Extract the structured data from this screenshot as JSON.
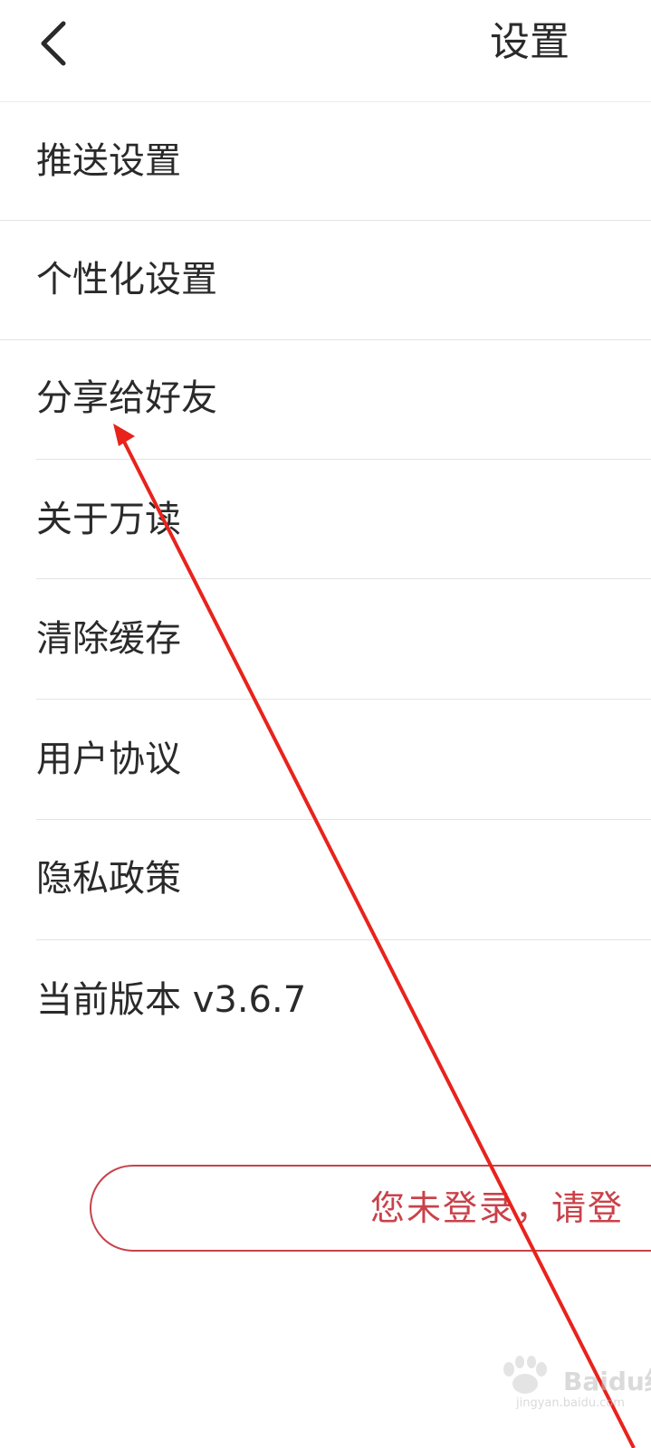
{
  "header": {
    "title": "设置",
    "back_icon": "chevron-left-icon"
  },
  "menu": {
    "items": [
      {
        "label": "推送设置"
      },
      {
        "label": "个性化设置"
      },
      {
        "label": "分享给好友"
      },
      {
        "label": "关于万读"
      },
      {
        "label": "清除缓存"
      },
      {
        "label": "用户协议"
      },
      {
        "label": "隐私政策"
      },
      {
        "label": "当前版本 v3.6.7"
      }
    ]
  },
  "login": {
    "label": "您未登录，请登"
  },
  "colors": {
    "accent": "#c9424a",
    "annotation": "#e8231c",
    "text": "#2a2a2a",
    "divider": "#e3e3e3"
  },
  "watermark": {
    "text": "Baidu经验",
    "sub": "jingyan.baidu.com"
  }
}
